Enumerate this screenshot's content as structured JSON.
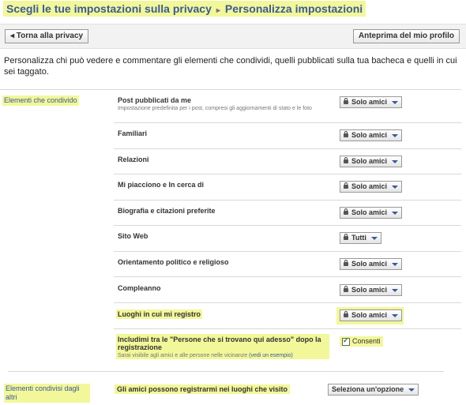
{
  "header": {
    "title": "Scegli le tue impostazioni sulla privacy",
    "separator": "▸",
    "subtitle": "Personalizza impostazioni"
  },
  "toolbar": {
    "back_label": "◂ Torna alla privacy",
    "preview_label": "Anteprima del mio profilo"
  },
  "intro": "Personalizza chi può vedere e commentare gli elementi che condividi, quelli pubblicati sulla tua bacheca e quelli in cui sei taggato.",
  "sections": {
    "shared_by_me": "Elementi che condivido",
    "shared_by_others": "Elementi condivisi dagli altri"
  },
  "rows": [
    {
      "label": "Post pubblicati da me",
      "desc": "Impostazione predefinita per i post, compresi gli aggiornamenti di stato e le foto",
      "value": "Solo amici"
    },
    {
      "label": "Familiari",
      "value": "Solo amici"
    },
    {
      "label": "Relazioni",
      "value": "Solo amici"
    },
    {
      "label": "Mi piacciono e In cerca di",
      "value": "Solo amici"
    },
    {
      "label": "Biografia e citazioni preferite",
      "value": "Solo amici"
    },
    {
      "label": "Sito Web",
      "value": "Tutti"
    },
    {
      "label": "Orientamento politico e religioso",
      "value": "Solo amici"
    },
    {
      "label": "Compleanno",
      "value": "Solo amici"
    },
    {
      "label": "Luoghi in cui mi registro",
      "value": "Solo amici"
    }
  ],
  "nearby": {
    "label": "Includimi tra le \"Persone che si trovano qui adesso\" dopo la registrazione",
    "desc": "Sarai visibile agli amici e alle persone nelle vicinanze",
    "desc_link": "(vedi un esempio)",
    "checkbox_label": "Consenti"
  },
  "others": {
    "label": "Gli amici possono registrarmi nei luoghi che visito",
    "select": "Seleziona un'opzione"
  },
  "colors": {
    "highlight": "#f2f799",
    "link": "#3b5998"
  }
}
